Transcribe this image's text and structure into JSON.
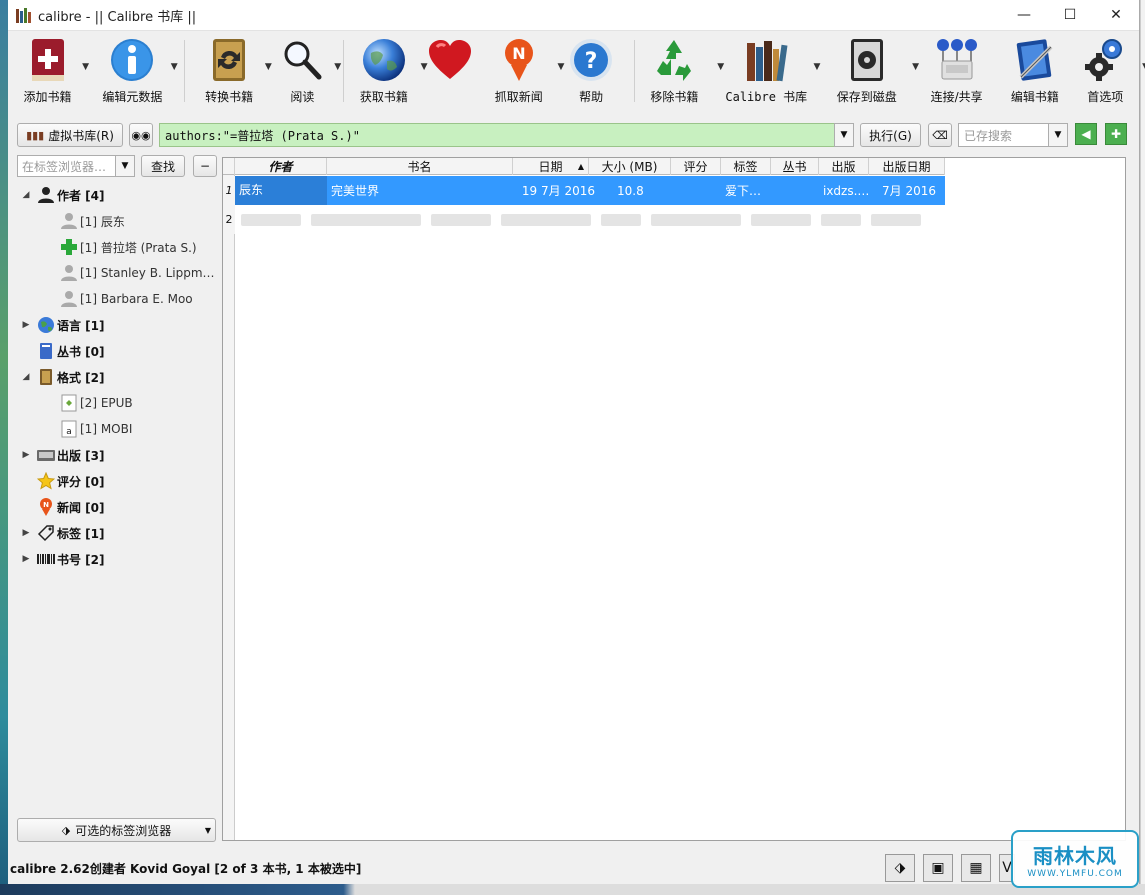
{
  "window": {
    "title": "calibre - || Calibre 书库 ||",
    "minimize": "—",
    "maximize": "☐",
    "close": "✕"
  },
  "toolbar": {
    "items": [
      {
        "label": "添加书籍",
        "icon": "add-book-icon"
      },
      {
        "label": "编辑元数据",
        "icon": "info-icon"
      },
      {
        "label": "转换书籍",
        "icon": "convert-icon"
      },
      {
        "label": "阅读",
        "icon": "magnifier-icon"
      },
      {
        "label": "获取书籍",
        "icon": "globe-icon"
      },
      {
        "label": "",
        "icon": "heart-icon"
      },
      {
        "label": "抓取新闻",
        "icon": "news-icon"
      },
      {
        "label": "帮助",
        "icon": "help-icon"
      },
      {
        "label": "移除书籍",
        "icon": "recycle-icon"
      },
      {
        "label": "Calibre 书库",
        "icon": "library-icon"
      },
      {
        "label": "保存到磁盘",
        "icon": "save-disk-icon"
      },
      {
        "label": "连接/共享",
        "icon": "connect-share-icon"
      },
      {
        "label": "编辑书籍",
        "icon": "edit-book-icon"
      },
      {
        "label": "首选项",
        "icon": "preferences-icon"
      }
    ]
  },
  "search": {
    "virtual_library": "虚拟书库(R)",
    "query": "authors:\"=普拉塔 (Prata S.)\"",
    "execute": "执行(G)",
    "saved_search_placeholder": "已存搜索"
  },
  "tag_browser": {
    "find_placeholder": "在标签浏览器…",
    "find_button": "查找",
    "collapse_button": "−",
    "categories": [
      {
        "label": "作者 [4]",
        "expanded": true,
        "icon": "person-icon",
        "children": [
          {
            "label": "[1] 辰东",
            "icon": "person-gray-icon"
          },
          {
            "label": "[1] 普拉塔 (Prata S.)",
            "icon": "plus-green-icon"
          },
          {
            "label": "[1] Stanley B. Lippm…",
            "icon": "person-gray-icon"
          },
          {
            "label": "[1] Barbara E. Moo",
            "icon": "person-gray-icon"
          }
        ]
      },
      {
        "label": "语言 [1]",
        "expanded": false,
        "icon": "languages-icon",
        "children": []
      },
      {
        "label": "丛书 [0]",
        "expanded": null,
        "icon": "series-icon",
        "children": []
      },
      {
        "label": "格式 [2]",
        "expanded": true,
        "icon": "book-format-icon",
        "children": [
          {
            "label": "[2] EPUB",
            "icon": "epub-icon"
          },
          {
            "label": "[1] MOBI",
            "icon": "mobi-icon"
          }
        ]
      },
      {
        "label": "出版 [3]",
        "expanded": false,
        "icon": "publisher-icon",
        "children": []
      },
      {
        "label": "评分 [0]",
        "expanded": null,
        "icon": "star-icon",
        "children": []
      },
      {
        "label": "新闻 [0]",
        "expanded": null,
        "icon": "news-small-icon",
        "children": []
      },
      {
        "label": "标签 [1]",
        "expanded": false,
        "icon": "tag-icon",
        "children": []
      },
      {
        "label": "书号 [2]",
        "expanded": false,
        "icon": "barcode-icon",
        "children": []
      }
    ],
    "alt_browser": "可选的标签浏览器"
  },
  "booklist": {
    "columns": [
      "作者",
      "书名",
      "日期",
      "大小 (MB)",
      "评分",
      "标签",
      "丛书",
      "出版",
      "出版日期"
    ],
    "rows": [
      {
        "num": "1",
        "author": "辰东",
        "title": "完美世界",
        "date": "19 7月 2016",
        "size": "10.8",
        "rating": "",
        "tags": "爱下…",
        "series": "",
        "publisher": "ixdzs.…",
        "pubdate": "7月 2016"
      },
      {
        "num": "2",
        "author": "",
        "title": "",
        "date": "",
        "size": "",
        "rating": "",
        "tags": "",
        "series": "",
        "publisher": "",
        "pubdate": ""
      }
    ]
  },
  "status": {
    "text": "calibre 2.62创建者 Kovid Goyal    [2 of 3 本书, 1 本被选中]"
  },
  "watermark": {
    "main": "雨林木风",
    "sub": "WWW.YLMFU.COM"
  }
}
